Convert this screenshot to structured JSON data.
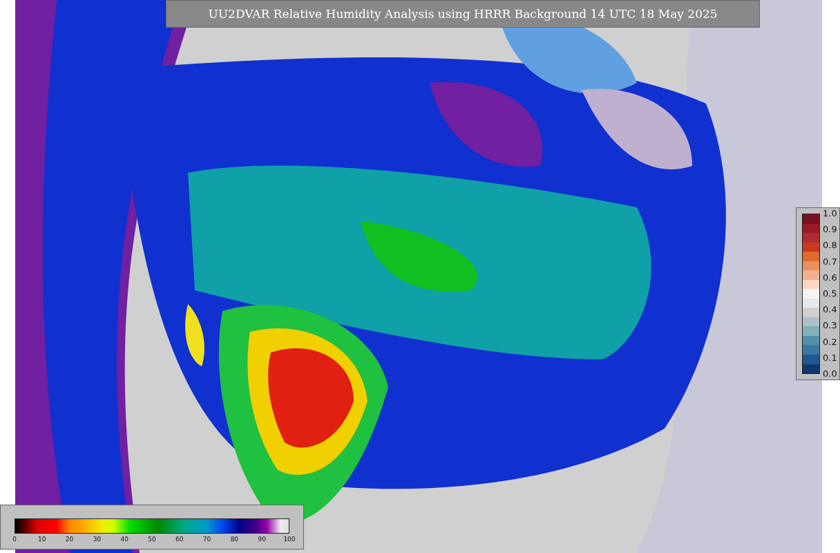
{
  "title": "UU2DVAR Relative Humidity Analysis using HRRR Background 14 UTC 18 May 2025",
  "station_scale": {
    "labels": [
      "1.0",
      "0.9",
      "0.8",
      "0.7",
      "0.6",
      "0.5",
      "0.4",
      "0.3",
      "0.2",
      "0.1",
      "0.0"
    ]
  },
  "humidity_scale": {
    "labels": [
      "0",
      "10",
      "20",
      "30",
      "40",
      "50",
      "60",
      "70",
      "80",
      "90",
      "100"
    ]
  }
}
